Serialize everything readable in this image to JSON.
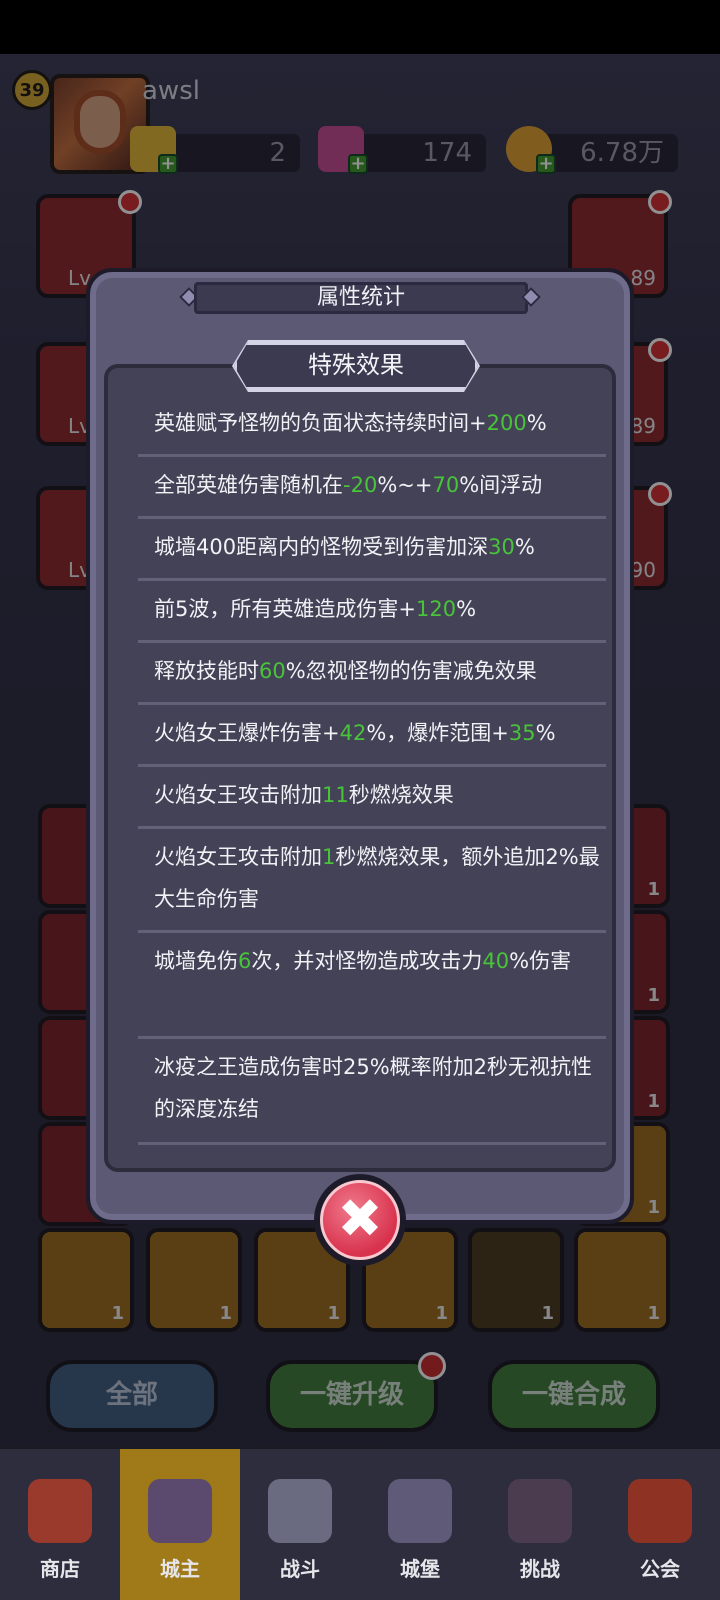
{
  "player": {
    "level": "39",
    "name": "awsl"
  },
  "currencies": [
    {
      "icon": "gold-gem-icon",
      "value": "2"
    },
    {
      "icon": "pink-crystal-icon",
      "value": "174"
    },
    {
      "icon": "coin-icon",
      "value": "6.78万"
    }
  ],
  "side_cards_left": [
    {
      "label": "Lv"
    },
    {
      "label": "Lv"
    },
    {
      "label": "Lv"
    }
  ],
  "side_cards_right": [
    {
      "label": ".89"
    },
    {
      "label": ".89"
    },
    {
      "label": ".90"
    }
  ],
  "modal": {
    "title": "属性统计",
    "section": "特殊效果",
    "effects": [
      {
        "parts": [
          "英雄赋予怪物的负面状态持续时间+",
          "200",
          "%"
        ]
      },
      {
        "parts": [
          "全部英雄伤害随机在",
          "-20",
          "%~+",
          "70",
          "%间浮动"
        ]
      },
      {
        "parts": [
          "城墙400距离内的怪物受到伤害加深",
          "30",
          "%"
        ]
      },
      {
        "parts": [
          "前5波，所有英雄造成伤害+",
          "120",
          "%"
        ]
      },
      {
        "parts": [
          "释放技能时",
          "60",
          "%忽视怪物的伤害减免效果"
        ]
      },
      {
        "parts": [
          "火焰女王爆炸伤害+",
          "42",
          "%，爆炸范围+",
          "35",
          "%"
        ]
      },
      {
        "parts": [
          "火焰女王攻击附加",
          "11",
          "秒燃烧效果"
        ]
      },
      {
        "parts": [
          "火焰女王攻击附加",
          "1",
          "秒燃烧效果，额外追加2%最大生命伤害"
        ]
      },
      {
        "parts": [
          "城墙免伤",
          "6",
          "次，并对怪物造成攻击力",
          "40",
          "%伤害"
        ]
      },
      {
        "parts": [
          "冰疫之王造成伤害时25%概率附加2秒无视抗性的深度冻结"
        ]
      }
    ],
    "close_icon": "close-x-icon"
  },
  "grid_counts": [
    "1",
    "1",
    "1",
    "1",
    "1",
    "1",
    "1",
    "1",
    "1",
    "1"
  ],
  "actions": {
    "all": "全部",
    "upgrade": "一键升级",
    "merge": "一键合成"
  },
  "nav": [
    {
      "label": "商店",
      "icon": "shop-icon"
    },
    {
      "label": "城主",
      "icon": "lord-icon"
    },
    {
      "label": "战斗",
      "icon": "battle-icon"
    },
    {
      "label": "城堡",
      "icon": "castle-icon"
    },
    {
      "label": "挑战",
      "icon": "challenge-icon"
    },
    {
      "label": "公会",
      "icon": "guild-icon"
    }
  ],
  "colors": {
    "highlight": "#49c43a",
    "modal_bg": "#5b5973",
    "active_tab": "#a07a18"
  }
}
